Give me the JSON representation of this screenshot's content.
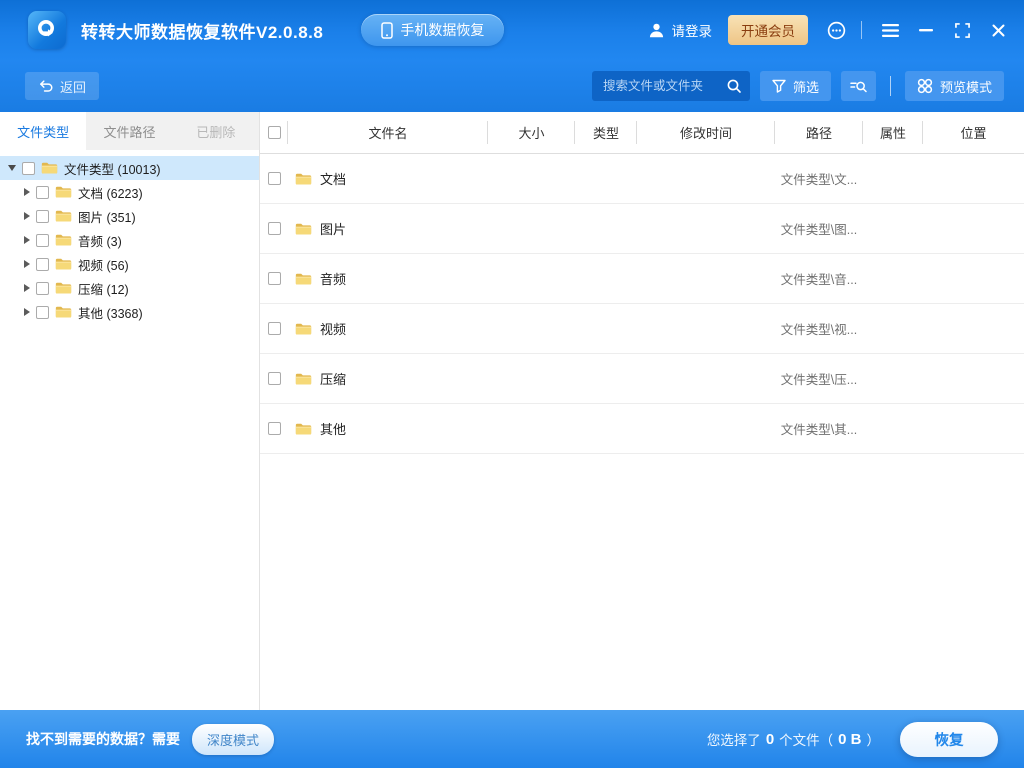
{
  "palette": {
    "primary_blue": "#1a7de6",
    "toolbar_button_blue": "#4496ef",
    "search_field_blue": "#0e64c6",
    "vip_badge_bg": "#f3d39b",
    "vip_badge_text": "#8a3d0f",
    "selected_row_bg": "#cfe8fc",
    "active_tab_text": "#1a7ae0",
    "folder_yellow": "#f6d978",
    "recover_text": "#2287ea"
  },
  "titlebar": {
    "title": "转转大师数据恢复软件V2.0.8.8",
    "phone_recovery_label": "手机数据恢复",
    "login_label": "请登录",
    "vip_label": "开通会员"
  },
  "toolbar": {
    "back_label": "返回",
    "search_placeholder": "搜索文件或文件夹",
    "filter_label": "筛选",
    "preview_label": "预览模式"
  },
  "sidebar": {
    "tabs": [
      {
        "label": "文件类型",
        "active": true
      },
      {
        "label": "文件路径",
        "active": false
      },
      {
        "label": "已删除",
        "active": false
      }
    ],
    "tree": [
      {
        "label": "文件类型 (10013)",
        "level": 0,
        "expanded": true,
        "selected": true
      },
      {
        "label": "文档 (6223)",
        "level": 1
      },
      {
        "label": "图片 (351)",
        "level": 1
      },
      {
        "label": "音频 (3)",
        "level": 1
      },
      {
        "label": "视频 (56)",
        "level": 1
      },
      {
        "label": "压缩 (12)",
        "level": 1
      },
      {
        "label": "其他 (3368)",
        "level": 1
      }
    ]
  },
  "table": {
    "columns": [
      "文件名",
      "大小",
      "类型",
      "修改时间",
      "路径",
      "属性",
      "位置"
    ],
    "rows": [
      {
        "name": "文档",
        "path": "文件类型\\文..."
      },
      {
        "name": "图片",
        "path": "文件类型\\图..."
      },
      {
        "name": "音频",
        "path": "文件类型\\音..."
      },
      {
        "name": "视频",
        "path": "文件类型\\视..."
      },
      {
        "name": "压缩",
        "path": "文件类型\\压..."
      },
      {
        "name": "其他",
        "path": "文件类型\\其..."
      }
    ]
  },
  "footer": {
    "hint_text": "找不到需要的数据？需要",
    "deep_mode_label": "深度模式",
    "selection_prefix": "您选择了",
    "selected_count": "0",
    "selection_mid": "个文件（",
    "selected_size": "0 B",
    "selection_suffix": "）",
    "recover_label": "恢复"
  }
}
